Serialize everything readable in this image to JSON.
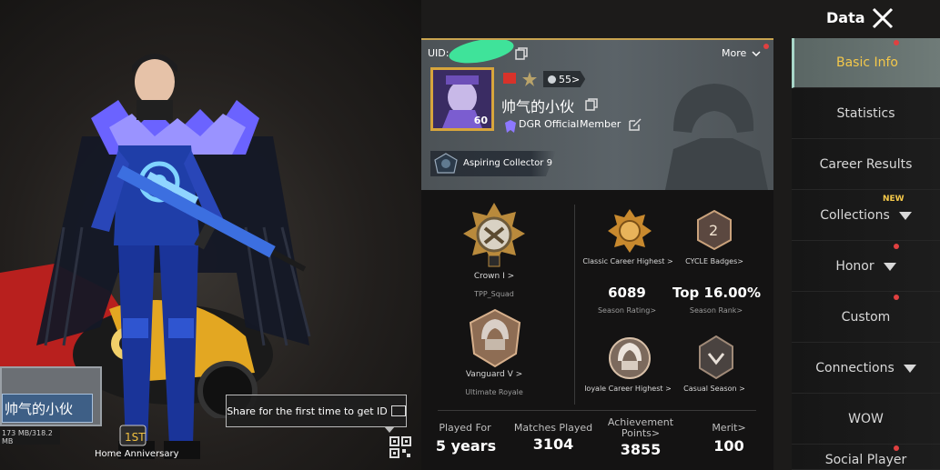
{
  "header": {
    "title": "Data"
  },
  "sidebar": {
    "items": [
      {
        "label": "Basic Info",
        "active": true
      },
      {
        "label": "Statistics"
      },
      {
        "label": "Career Results"
      },
      {
        "label": "Collections"
      },
      {
        "label": "Honor"
      },
      {
        "label": "Custom"
      },
      {
        "label": "Connections"
      },
      {
        "label": "WOW"
      },
      {
        "label": "Social Player"
      }
    ],
    "new_badge": "NEW"
  },
  "profile": {
    "uid_label": "UID:",
    "more_label": "More",
    "level_badge": "55>",
    "avatar_level": "60",
    "nickname": "帅气的小伙",
    "clan_name": "DGR Official",
    "clan_role": "Member",
    "title": "Aspiring Collector 9"
  },
  "stats": {
    "tpp": {
      "caption": "Crown I >",
      "sub": "TPP_Squad"
    },
    "ultimate": {
      "caption": "Vanguard V >",
      "sub": "Ultimate Royale"
    },
    "classic_highest": "Classic Career Highest >",
    "cycle_badges": "CYCLE Badges>",
    "season_rating": {
      "value": "6089",
      "label": "Season Rating>"
    },
    "season_rank": {
      "value": "Top 16.00%",
      "label": "Season Rank>"
    },
    "loyale_highest": "loyale Career Highest >",
    "casual_season": "Casual Season >",
    "cycle_number": "2"
  },
  "summary": {
    "played_for": {
      "label": "Played For",
      "value": "5 years"
    },
    "matches": {
      "label": "Matches Played",
      "value": "3104"
    },
    "achievement": {
      "label": "Achievement Points>",
      "value": "3855"
    },
    "merit": {
      "label": "Merit>",
      "value": "100"
    }
  },
  "left": {
    "nameplate": "帅气的小伙",
    "size_text": "173 MB/318.2 MB",
    "anniversary_label": "Home Anniversary",
    "share_tip": "Share for the first time to get ID"
  }
}
